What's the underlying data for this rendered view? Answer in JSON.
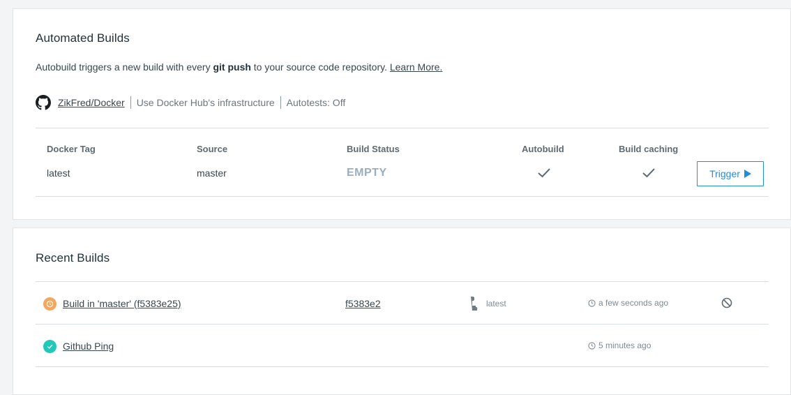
{
  "automated_builds": {
    "title": "Automated Builds",
    "desc_before": "Autobuild triggers a new build with every ",
    "desc_bold": "git push",
    "desc_after": " to your source code repository. ",
    "learn_more": "Learn More.",
    "repo": "ZikFred/Docker",
    "infrastructure": "Use Docker Hub's infrastructure",
    "autotests": "Autotests: Off",
    "table": {
      "headers": {
        "tag": "Docker Tag",
        "source": "Source",
        "status": "Build Status",
        "autobuild": "Autobuild",
        "caching": "Build caching"
      },
      "row": {
        "tag": "latest",
        "source": "master",
        "status": "EMPTY",
        "autobuild": true,
        "caching": true
      },
      "trigger_label": "Trigger"
    }
  },
  "recent_builds": {
    "title": "Recent Builds",
    "items": [
      {
        "name": "Build in 'master' (f5383e25)",
        "status": "pending",
        "commit": "f5383e2",
        "tag": "latest",
        "time": "a few seconds ago",
        "has_cancel": true
      },
      {
        "name": "Github Ping",
        "status": "success",
        "time": "5 minutes ago"
      }
    ]
  },
  "colors": {
    "accent": "#1d8ed8",
    "pending": "#f4a65f",
    "success": "#1fc8b8",
    "empty_status": "#9aaec0"
  }
}
